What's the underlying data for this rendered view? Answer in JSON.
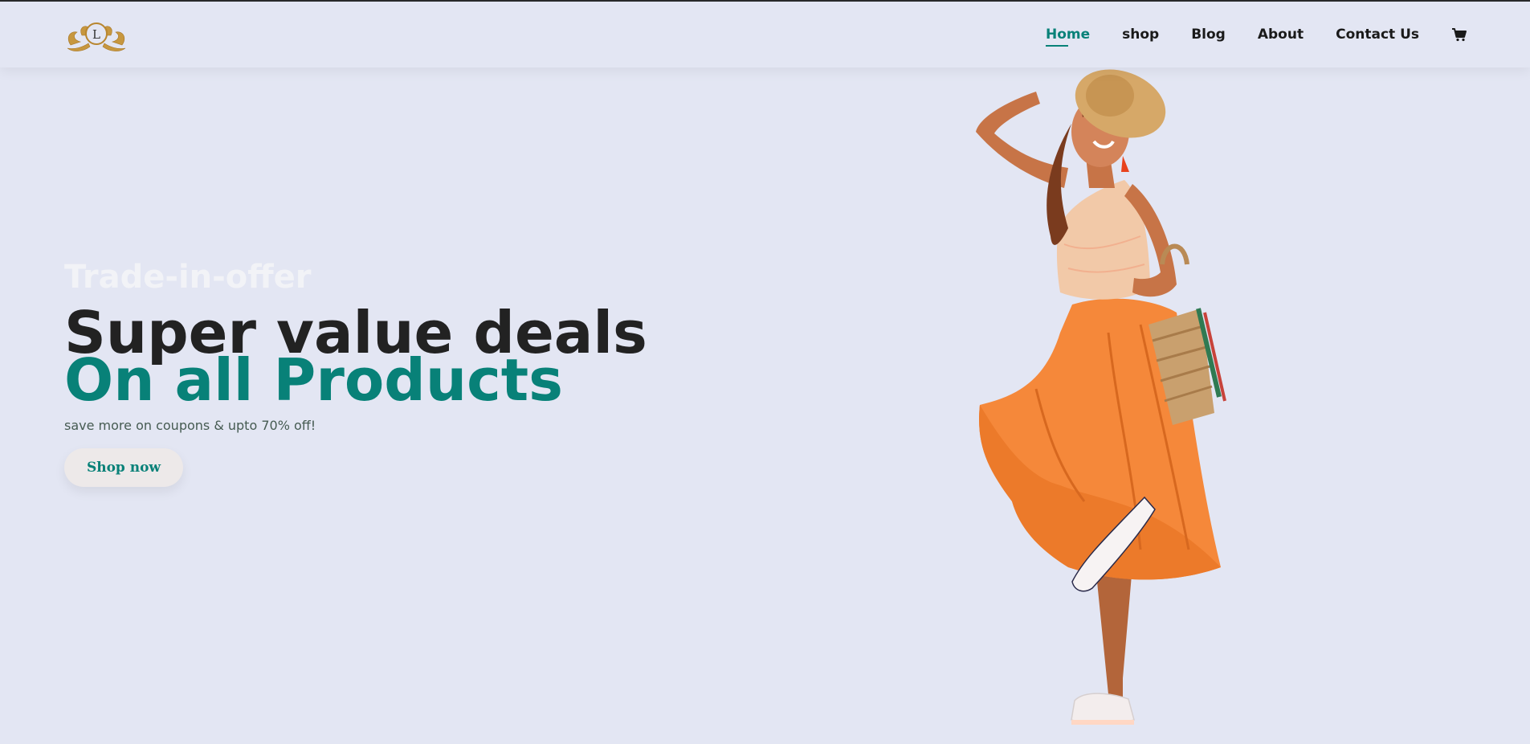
{
  "header": {
    "logo_letter": "L",
    "nav": [
      {
        "label": "Home",
        "active": true
      },
      {
        "label": "shop",
        "active": false
      },
      {
        "label": "Blog",
        "active": false
      },
      {
        "label": "About",
        "active": false
      },
      {
        "label": "Contact Us",
        "active": false
      }
    ],
    "cart_icon": "cart-icon"
  },
  "hero": {
    "subtitle": "Trade-in-offer",
    "title_line1": "Super value deals",
    "title_line2": "On all Products",
    "description": "save more on coupons & upto 70% off!",
    "cta_label": "Shop now"
  },
  "colors": {
    "accent": "#088178",
    "background": "#e3e6f3",
    "dress": "#f5883a"
  }
}
